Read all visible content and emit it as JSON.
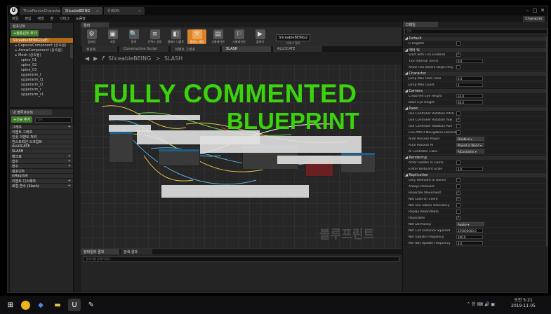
{
  "titlebar": {
    "tabs": [
      "ThirdPersonCharacter",
      "SlicableBEING",
      "위레ON"
    ],
    "controls": [
      "–",
      "□",
      "✕"
    ],
    "user": "Character"
  },
  "menu": [
    "파일",
    "편집",
    "애셋",
    "창",
    "디버그",
    "도움말"
  ],
  "left": {
    "tab": "컴포넌트",
    "add_button": "+컴포넌트 추가",
    "root": "SliceableBEING(self)",
    "components": [
      "CapsuleComponent (상속됨)",
      "ArrowComponent (상속됨)",
      "Mesh (상속됨)",
      "spine_01",
      "spine_02",
      "spine_03",
      "upperarm_l",
      "upperarm_l1",
      "upperarm_l2",
      "upperarm_r",
      "upperarm_r1"
    ],
    "mybp_tab": "내 블루프린트",
    "mybp_add": "+신규 추가",
    "mybp_search": "검색",
    "sections": [
      {
        "label": "그래프",
        "plus": "+"
      },
      {
        "label": "이벤트 그래프",
        "plus": ""
      },
      {
        "label": "인풋 이벤트 처리",
        "plus": ""
      },
      {
        "label": "컨스트럭션 스크립트",
        "plus": ""
      },
      {
        "label": "ALLOCATE",
        "plus": ""
      },
      {
        "label": "SLASH",
        "plus": ""
      },
      {
        "label": "매크로",
        "plus": "+"
      },
      {
        "label": "함수",
        "plus": "+"
      },
      {
        "label": "변수",
        "plus": "+"
      },
      {
        "label": "컴포넌트",
        "plus": ""
      },
      {
        "label": "isRagdoll",
        "plus": ""
      },
      {
        "label": "이벤트 디스패처",
        "plus": "+"
      },
      {
        "label": "로컬 변수 (Slash)",
        "plus": "+"
      }
    ]
  },
  "toolbar": {
    "items": [
      {
        "label": "컴파일",
        "icon": "⚙"
      },
      {
        "label": "저장",
        "icon": "▣"
      },
      {
        "label": "탐색",
        "icon": "🔍"
      },
      {
        "label": "인덱스 설정",
        "icon": "≡"
      },
      {
        "label": "클래스 디폴트",
        "icon": "◧"
      },
      {
        "label": "클래스 세팅",
        "icon": "⚒"
      },
      {
        "label": "시뮬레이션",
        "icon": "▤"
      },
      {
        "label": "시뮬레이션",
        "icon": "⚐"
      },
      {
        "label": "플레이",
        "icon": "▶"
      }
    ],
    "debug_object": "SliceableBEING2",
    "debug_label": "디버그 필터"
  },
  "graph": {
    "tabs": [
      "뷰포트",
      "Construction Script",
      "이벤트 그래프",
      "SLASH",
      "ALLOCATE"
    ],
    "breadcrumb_fn": "SliceableBEING",
    "breadcrumb_sep": ">",
    "breadcrumb_graph": "SLASH",
    "title_line1": "FULLY COMMENTED",
    "title_line2": "BLUEPRINT",
    "watermark": "블루프린트"
  },
  "findres": {
    "tabs": [
      "컴파일러 결과",
      "검색 결과"
    ],
    "placeholder": "검색어를 입력하세요..."
  },
  "details": {
    "tab": "디테일",
    "search": "검색",
    "sections": [
      {
        "title": "Default",
        "props": [
          {
            "name": "Is Ragdoll",
            "type": "check",
            "value": ""
          }
        ]
      },
      {
        "title": "액터 틱",
        "props": [
          {
            "name": "Start with Tick Enabled",
            "type": "check",
            "value": "✓"
          },
          {
            "name": "Tick Interval (secs)",
            "type": "num",
            "value": "0.0"
          },
          {
            "name": "Allow Tick Before Begin Play",
            "type": "check",
            "value": ""
          }
        ]
      },
      {
        "title": "Character",
        "props": [
          {
            "name": "Jump Max Hold Time",
            "type": "num",
            "value": "0.0"
          },
          {
            "name": "Jump Max Count",
            "type": "num",
            "value": "1"
          }
        ]
      },
      {
        "title": "Camera",
        "props": [
          {
            "name": "Crouched Eye Height",
            "type": "num",
            "value": "32.0"
          },
          {
            "name": "Base Eye Height",
            "type": "num",
            "value": "64.0"
          }
        ]
      },
      {
        "title": "Pawn",
        "props": [
          {
            "name": "Use Controller Rotation Pitch",
            "type": "check",
            "value": ""
          },
          {
            "name": "Use Controller Rotation Yaw",
            "type": "check",
            "value": "✓"
          },
          {
            "name": "Use Controller Rotation Roll",
            "type": "check",
            "value": ""
          },
          {
            "name": "Can Affect Navigation Generation",
            "type": "check",
            "value": ""
          },
          {
            "name": "Auto Possess Player",
            "type": "select",
            "value": "Disabled"
          },
          {
            "name": "Auto Possess AI",
            "type": "select",
            "value": "Placed in World"
          },
          {
            "name": "AI Controller Class",
            "type": "select",
            "value": "AIController"
          }
        ]
      },
      {
        "title": "Rendering",
        "props": [
          {
            "name": "Actor Hidden In Game",
            "type": "check",
            "value": ""
          },
          {
            "name": "Editor Billboard Scale",
            "type": "num",
            "value": "1.0"
          }
        ]
      },
      {
        "title": "Replication",
        "props": [
          {
            "name": "Only Relevant to Owner",
            "type": "check",
            "value": ""
          },
          {
            "name": "Always Relevant",
            "type": "check",
            "value": ""
          },
          {
            "name": "Replicate Movement",
            "type": "check",
            "value": "✓"
          },
          {
            "name": "Net Load on Client",
            "type": "check",
            "value": "✓"
          },
          {
            "name": "Net Use Owner Relevancy",
            "type": "check",
            "value": ""
          },
          {
            "name": "Replay Rewindable",
            "type": "check",
            "value": ""
          },
          {
            "name": "Replicates",
            "type": "check",
            "value": "✓"
          },
          {
            "name": "Net Dormancy",
            "type": "select",
            "value": "Awake"
          },
          {
            "name": "Net Cull Distance Squared",
            "type": "num",
            "value": "225000000.0"
          },
          {
            "name": "Net Update Frequency",
            "type": "num",
            "value": "100.0"
          },
          {
            "name": "Min Net Update Frequency",
            "type": "num",
            "value": "2.0"
          }
        ]
      }
    ]
  },
  "taskbar": {
    "time": "오전 5:21",
    "date": "2019-11-05",
    "tray": "^ 한 ⌨ 🔊 ▣"
  }
}
